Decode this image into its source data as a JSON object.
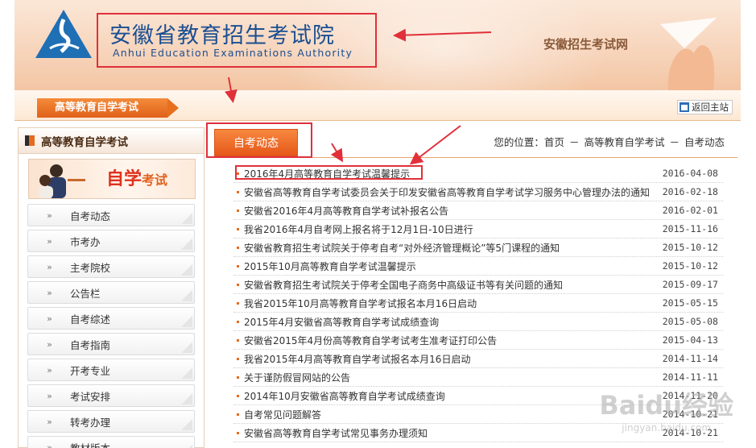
{
  "header": {
    "title_cn": "安徽省教育招生考试院",
    "title_en": "Anhui Education Examinations Authority",
    "right_text": "安徽招生考试网"
  },
  "subbar": {
    "section_tab": "高等教育自学考试",
    "home_link": "返回主站"
  },
  "sidebar": {
    "heading": "高等教育自学考试",
    "banner_big": "自学",
    "banner_small": "考试",
    "items": [
      {
        "label": "自考动态"
      },
      {
        "label": "市考办"
      },
      {
        "label": "主考院校"
      },
      {
        "label": "公告栏"
      },
      {
        "label": "自考综述"
      },
      {
        "label": "自考指南"
      },
      {
        "label": "开考专业"
      },
      {
        "label": "考试安排"
      },
      {
        "label": "转考办理"
      },
      {
        "label": "教材版本"
      }
    ]
  },
  "main": {
    "active_tab": "自考动态",
    "breadcrumb": {
      "prefix": "您的位置：",
      "home": "首页",
      "section": "高等教育自学考试",
      "current": "自考动态",
      "sep": "－"
    },
    "news": [
      {
        "title": "2016年4月高等教育自学考试温馨提示",
        "date": "2016-04-08"
      },
      {
        "title": "安徽省高等教育自学考试委员会关于印发安徽省高等教育自学考试学习服务中心管理办法的通知",
        "date": "2016-02-18"
      },
      {
        "title": "安徽省2016年4月高等教育自学考试补报名公告",
        "date": "2016-02-01"
      },
      {
        "title": "我省2016年4月自考网上报名将于12月1日-10日进行",
        "date": "2015-11-16"
      },
      {
        "title": "安徽省教育招生考试院关于停考自考“对外经济管理概论”等5门课程的通知",
        "date": "2015-10-12"
      },
      {
        "title": "2015年10月高等教育自学考试温馨提示",
        "date": "2015-10-12"
      },
      {
        "title": "安徽省教育招生考试院关于停考全国电子商务中高级证书等有关问题的通知",
        "date": "2015-09-17"
      },
      {
        "title": "我省2015年10月高等教育自学考试报名本月16日启动",
        "date": "2015-05-15"
      },
      {
        "title": "2015年4月安徽省高等教育自学考试成绩查询",
        "date": "2015-05-08"
      },
      {
        "title": "安徽省2015年4月份高等教育自学考试考生准考证打印公告",
        "date": "2015-04-13"
      },
      {
        "title": "我省2015年4月高等教育自学考试报名本月16日启动",
        "date": "2014-11-14"
      },
      {
        "title": "关于谨防假冒网站的公告",
        "date": "2014-11-11"
      },
      {
        "title": "2014年10月安徽省高等教育自学考试成绩查询",
        "date": "2014-11-20"
      },
      {
        "title": "自考常见问题解答",
        "date": "2014-10-21"
      },
      {
        "title": "安徽省高等教育自学考试常见事务办理须知",
        "date": "2014-10-21"
      }
    ]
  },
  "watermark": {
    "main": "Baidu经验",
    "sub": "jingyan.baidu.com"
  },
  "colors": {
    "accent": "#e6581a",
    "title_blue": "#1b4f92",
    "annotation_red": "#e0303a"
  }
}
